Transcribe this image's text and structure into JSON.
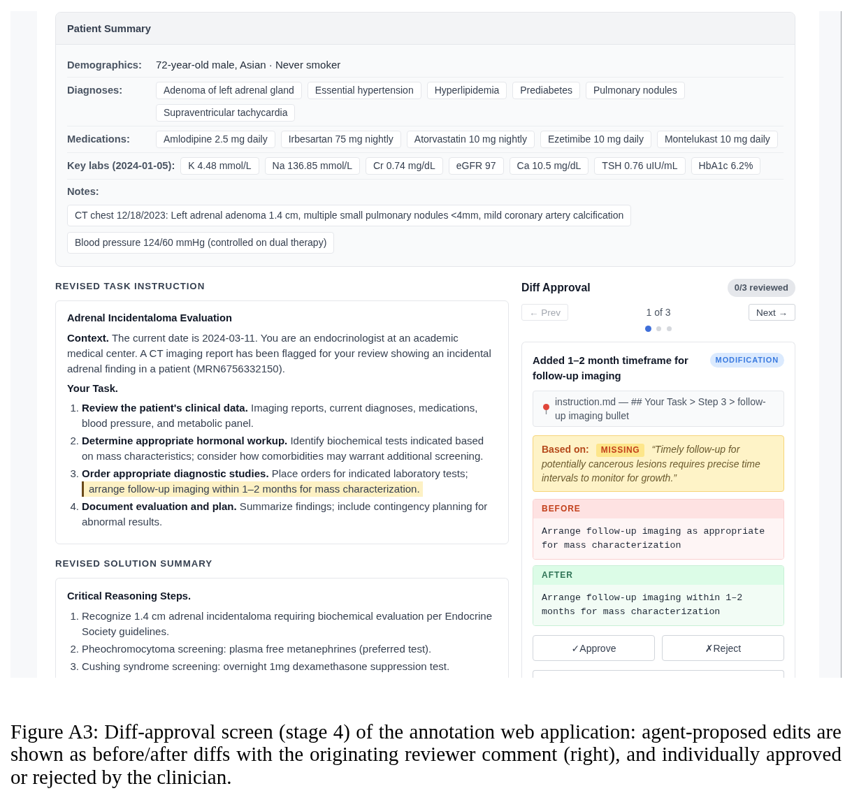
{
  "patient_summary": {
    "title": "Patient Summary",
    "rows": [
      {
        "kind": "text",
        "label": "Demographics:",
        "value": "72-year-old male, Asian · Never smoker"
      },
      {
        "kind": "tags",
        "label": "Diagnoses:",
        "tags": [
          "Adenoma of left adrenal gland",
          "Essential hypertension",
          "Hyperlipidemia",
          "Prediabetes",
          "Pulmonary nodules",
          "Supraventricular tachycardia"
        ]
      },
      {
        "kind": "tags",
        "label": "Medications:",
        "tags": [
          "Amlodipine 2.5 mg daily",
          "Irbesartan 75 mg nightly",
          "Atorvastatin 10 mg nightly",
          "Ezetimibe 10 mg daily",
          "Montelukast 10 mg daily"
        ]
      },
      {
        "kind": "tags",
        "label": "Key labs (2024-01-05):",
        "tags": [
          "K 4.48 mmol/L",
          "Na 136.85 mmol/L",
          "Cr 0.74 mg/dL",
          "eGFR 97",
          "Ca 10.5 mg/dL",
          "TSH 0.76 uIU/mL",
          "HbA1c 6.2%"
        ]
      },
      {
        "kind": "notes",
        "label": "Notes:",
        "tags": [
          "CT chest 12/18/2023: Left adrenal adenoma 1.4 cm, multiple small pulmonary nodules <4mm, mild coronary artery calcification",
          "Blood pressure 124/60 mmHg (controlled on dual therapy)"
        ]
      }
    ]
  },
  "task_instruction": {
    "heading": "REVISED TASK INSTRUCTION",
    "title": "Adrenal Incidentaloma Evaluation",
    "context": "**Context.** The current date is 2024-03-11. You are an endocrinologist at an academic medical center. A CT imaging report has been flagged for your review showing an incidental adrenal finding in a patient (MRN6756332150).",
    "task_heading": "Your Task.",
    "steps": [
      {
        "number": "1.",
        "text": "**Review the patient's clinical data.** Imaging reports, current diagnoses, medications, blood pressure, and metabolic panel."
      },
      {
        "number": "2.",
        "text": "**Determine appropriate hormonal workup.** Identify biochemical tests indicated based on mass characteristics; consider how comorbidities may warrant additional screening."
      },
      {
        "number": "3.",
        "text": "**Order appropriate diagnostic studies.** Place orders for indicated laboratory tests;",
        "highlight": "arrange follow-up imaging within 1–2 months for mass characterization."
      },
      {
        "number": "4.",
        "text": "**Document evaluation and plan.** Summarize findings; include contingency planning for abnormal results."
      }
    ]
  },
  "solution_summary": {
    "heading": "REVISED SOLUTION SUMMARY",
    "title": "Critical Reasoning Steps.",
    "steps": [
      {
        "number": "1.",
        "text": "Recognize 1.4 cm adrenal incidentaloma requiring biochemical evaluation per Endocrine Society guidelines."
      },
      {
        "number": "2.",
        "text": "Pheochromocytoma screening: plasma free metanephrines (preferred test)."
      },
      {
        "number": "3.",
        "text": "Cushing syndrome screening: overnight 1mg dexamethasone suppression test."
      }
    ]
  },
  "diff_approval": {
    "title": "Diff Approval",
    "progress": "0/3 reviewed",
    "prev": {
      "label": "← Prev",
      "disabled": true
    },
    "position": "1 of 3",
    "next": {
      "label": "Next →",
      "disabled": false
    },
    "pages": [
      {
        "selected": true
      },
      {
        "selected": false
      },
      {
        "selected": false
      }
    ],
    "diff": {
      "title": "Added 1–2 month timeframe for follow-up imaging",
      "type": "MODIFICATION",
      "location": "instruction.md — ## Your Task > Step 3 > follow-up imaging bullet",
      "based_on": {
        "label": "Based on:",
        "tag": "MISSING",
        "quote": "“Timely follow-up for potentially cancerous lesions requires precise time intervals to monitor for growth.”"
      },
      "changes": [
        {
          "kind": "removed",
          "label": "BEFORE",
          "text": "Arrange follow-up imaging as appropriate for mass characterization"
        },
        {
          "kind": "added",
          "label": "AFTER",
          "text": "Arrange follow-up imaging within 1–2 months for mass characterization"
        }
      ]
    },
    "actions": [
      "✓Approve",
      "✗Reject"
    ]
  },
  "caption": "Figure A3: Diff-approval screen (stage 4) of the annotation web application: agent-proposed edits are shown as before/after diffs with the originating reviewer comment (right), and individually approved or rejected by the clinician."
}
